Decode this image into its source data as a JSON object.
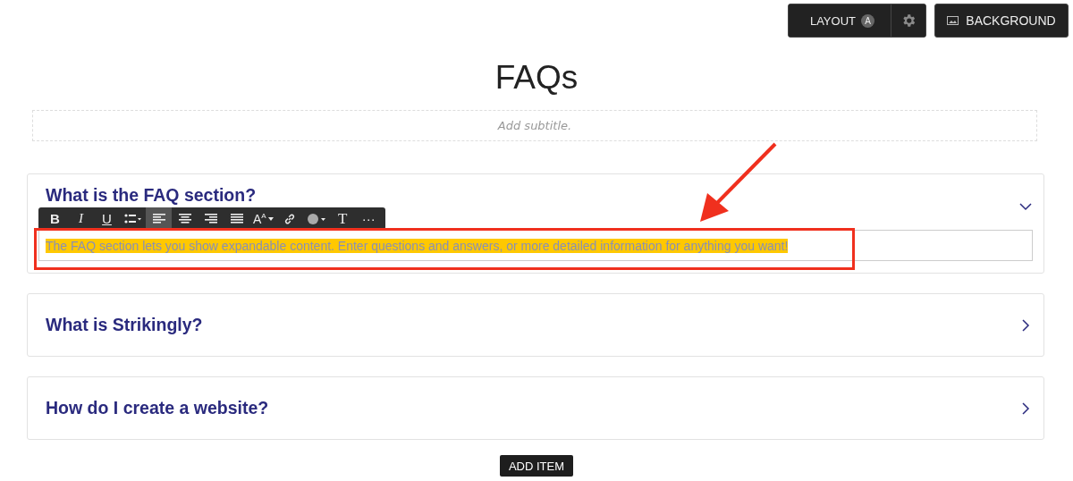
{
  "top_bar": {
    "layout_button": {
      "label": "LAYOUT",
      "badge": "A"
    },
    "background_button": {
      "label": "BACKGROUND"
    }
  },
  "title": "FAQs",
  "subtitle": {
    "placeholder": "Add subtitle."
  },
  "text_toolbar": [
    {
      "kind": "bold",
      "label": "B",
      "selected": false
    },
    {
      "kind": "italic",
      "label": "I",
      "selected": false
    },
    {
      "kind": "underline",
      "label": "U",
      "selected": false
    },
    {
      "kind": "bullet-list",
      "selected": false
    },
    {
      "kind": "align-left",
      "selected": true
    },
    {
      "kind": "align-center",
      "selected": false
    },
    {
      "kind": "align-right",
      "selected": false
    },
    {
      "kind": "justify",
      "selected": false
    },
    {
      "kind": "font-size",
      "label": "A$^{A}$",
      "selected": false
    },
    {
      "kind": "link",
      "selected": false
    },
    {
      "kind": "color",
      "selected": false
    },
    {
      "kind": "typeface",
      "label": "T",
      "selected": false
    },
    {
      "kind": "more",
      "label": "···",
      "selected": false
    }
  ],
  "faq_items": [
    {
      "question": "What is the FAQ section?",
      "expanded": true,
      "answer": "The FAQ section lets you show expandable content. Enter questions and answers, or more detailed information for anything you want!",
      "answer_selected": true
    },
    {
      "question": "What is Strikingly?",
      "expanded": false
    },
    {
      "question": "How do I create a website?",
      "expanded": false
    }
  ],
  "add_item_button": "ADD ITEM"
}
